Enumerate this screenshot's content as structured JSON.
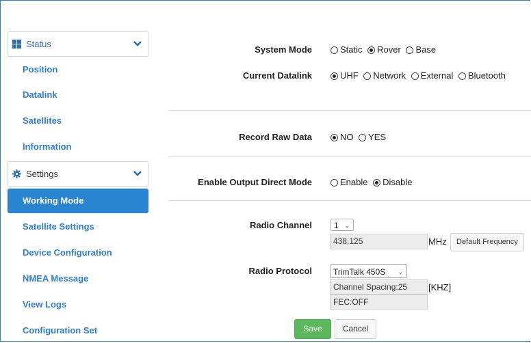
{
  "sidebar": {
    "status": {
      "label": "Status",
      "items": [
        "Position",
        "Datalink",
        "Satellites",
        "Information"
      ]
    },
    "settings": {
      "label": "Settings",
      "items": [
        "Working Mode",
        "Satellite Settings",
        "Device Configuration",
        "NMEA Message",
        "View Logs",
        "Configuration Set"
      ],
      "active": "Working Mode"
    }
  },
  "form": {
    "system_mode": {
      "label": "System Mode",
      "options": [
        "Static",
        "Rover",
        "Base"
      ],
      "selected": "Rover"
    },
    "current_datalink": {
      "label": "Current Datalink",
      "options": [
        "UHF",
        "Network",
        "External",
        "Bluetooth"
      ],
      "selected": "UHF"
    },
    "record_raw_data": {
      "label": "Record Raw Data",
      "options": [
        "NO",
        "YES"
      ],
      "selected": "NO"
    },
    "output_direct_mode": {
      "label": "Enable Output Direct Mode",
      "options": [
        "Enable",
        "Disable"
      ],
      "selected": "Disable"
    },
    "radio_channel": {
      "label": "Radio Channel",
      "value": "1",
      "frequency": "438.125",
      "unit": "MHz",
      "default_button": "Default Frequency"
    },
    "radio_protocol": {
      "label": "Radio Protocol",
      "value": "TrimTalk 450S",
      "channel_spacing": "Channel Spacing:25",
      "spacing_unit": "[KHZ]",
      "fec": "FEC:OFF"
    }
  },
  "buttons": {
    "save": "Save",
    "cancel": "Cancel"
  },
  "colors": {
    "accent": "#2a85d0",
    "link": "#2d7dd2",
    "save": "#5cb85c"
  }
}
